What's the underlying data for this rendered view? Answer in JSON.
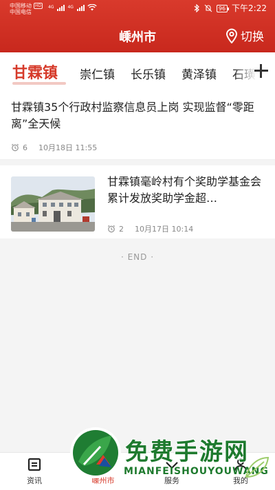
{
  "status_bar": {
    "carrier1": "中国移动",
    "hd": "HD",
    "carrier2": "中国电信",
    "net1": "4G",
    "net2": "4G",
    "battery": "96",
    "time": "下午2:22"
  },
  "header": {
    "title": "嵊州市",
    "switch_label": "切换"
  },
  "tabs": [
    {
      "label": "甘霖镇",
      "active": true
    },
    {
      "label": "崇仁镇"
    },
    {
      "label": "长乐镇"
    },
    {
      "label": "黄泽镇"
    },
    {
      "label": "石璜"
    }
  ],
  "articles": [
    {
      "title": "甘霖镇35个行政村监察信息员上岗 实现监督“零距离”全天候",
      "views": "6",
      "time": "10月18日 11:55"
    },
    {
      "title": "甘霖镇毫岭村有个奖助学基金会 累计发放奖助学金超…",
      "views": "2",
      "time": "10月17日 10:14",
      "thumbnail": "village-buildings-photo"
    }
  ],
  "end_label": "· END ·",
  "bottom_nav": [
    {
      "label": "资讯",
      "icon": "news-icon"
    },
    {
      "label": "嵊州市",
      "icon": "location-icon",
      "active": true
    },
    {
      "label": "服务",
      "icon": "service-icon"
    },
    {
      "label": "我的",
      "icon": "user-icon"
    }
  ],
  "watermark": {
    "title": "免费手游网",
    "subtitle": "MIANFEISHOUYOUWANG"
  },
  "colors": {
    "brand_red": "#d63a2a",
    "header_red": "#c8281d",
    "watermark_green": "#1e7a2e"
  }
}
